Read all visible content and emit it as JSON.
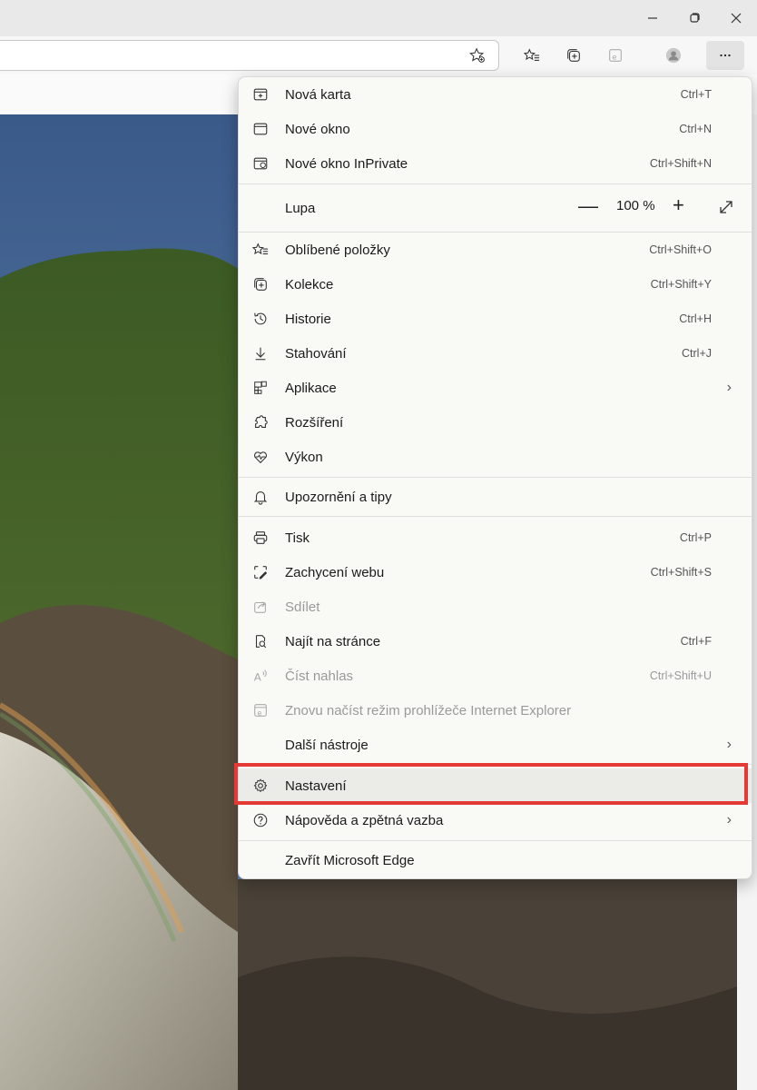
{
  "window": {
    "minimize_icon": "minimize-icon",
    "restore_icon": "restore-icon",
    "close_icon": "close-icon"
  },
  "toolbar": {
    "icons": [
      "add-favorite-icon",
      "favorites-icon",
      "collections-icon",
      "ie-mode-icon",
      "profile-icon",
      "more-icon"
    ]
  },
  "menu": {
    "items": [
      {
        "label": "Nová karta",
        "shortcut": "Ctrl+T",
        "icon": "new-tab-icon"
      },
      {
        "label": "Nové okno",
        "shortcut": "Ctrl+N",
        "icon": "new-window-icon"
      },
      {
        "label": "Nové okno InPrivate",
        "shortcut": "Ctrl+Shift+N",
        "icon": "inprivate-icon"
      },
      {
        "label": "Lupa",
        "zoom_value": "100 %",
        "icon": "none"
      },
      {
        "label": "Oblíbené položky",
        "shortcut": "Ctrl+Shift+O",
        "icon": "favorites-icon"
      },
      {
        "label": "Kolekce",
        "shortcut": "Ctrl+Shift+Y",
        "icon": "collections-icon"
      },
      {
        "label": "Historie",
        "shortcut": "Ctrl+H",
        "icon": "history-icon"
      },
      {
        "label": "Stahování",
        "shortcut": "Ctrl+J",
        "icon": "download-icon"
      },
      {
        "label": "Aplikace",
        "icon": "apps-icon",
        "submenu": true
      },
      {
        "label": "Rozšíření",
        "icon": "extensions-icon"
      },
      {
        "label": "Výkon",
        "icon": "performance-icon"
      },
      {
        "label": "Upozornění a tipy",
        "icon": "bell-icon"
      },
      {
        "label": "Tisk",
        "shortcut": "Ctrl+P",
        "icon": "print-icon"
      },
      {
        "label": "Zachycení webu",
        "shortcut": "Ctrl+Shift+S",
        "icon": "web-capture-icon"
      },
      {
        "label": "Sdílet",
        "icon": "share-icon",
        "disabled": true
      },
      {
        "label": "Najít na stránce",
        "shortcut": "Ctrl+F",
        "icon": "find-icon"
      },
      {
        "label": "Číst nahlas",
        "shortcut": "Ctrl+Shift+U",
        "icon": "read-aloud-icon",
        "disabled": true
      },
      {
        "label": "Znovu načíst režim prohlížeče Internet Explorer",
        "icon": "ie-mode-icon",
        "disabled": true
      },
      {
        "label": "Další nástroje",
        "icon": "none",
        "submenu": true
      },
      {
        "label": "Nastavení",
        "icon": "gear-icon",
        "highlighted": true
      },
      {
        "label": "Nápověda a zpětná vazba",
        "icon": "help-icon",
        "submenu": true
      },
      {
        "label": "Zavřít Microsoft Edge",
        "icon": "none"
      }
    ]
  },
  "colors": {
    "highlight_border": "#e53935",
    "menu_bg": "#f9f9f6"
  }
}
